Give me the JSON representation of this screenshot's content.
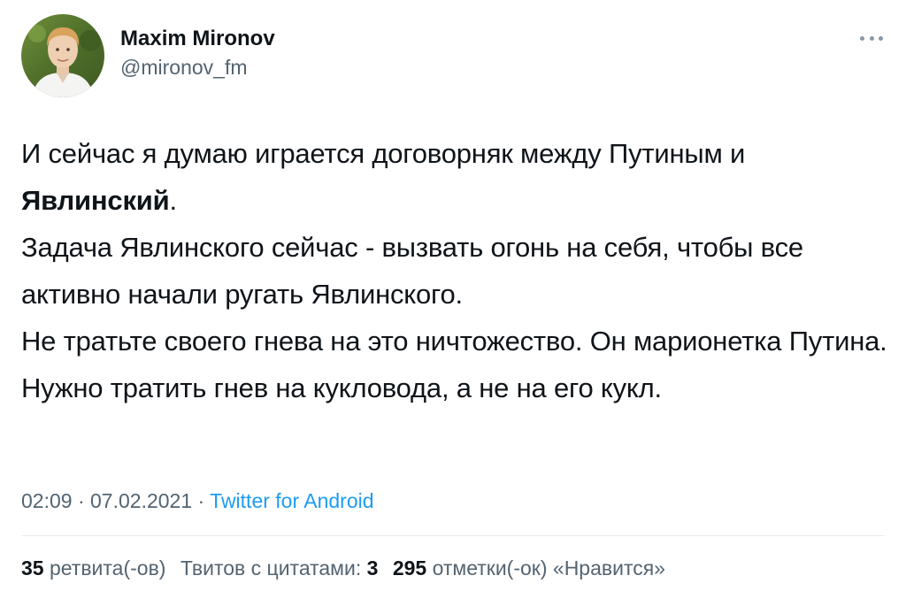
{
  "author": {
    "name": "Maxim Mironov",
    "handle": "@mironov_fm"
  },
  "tweet": {
    "line1": "И сейчас я думаю играется договорняк между Путиным и",
    "bold_name": "Явлинский",
    "bold_suffix": ".",
    "paragraph2": "Задача Явлинского сейчас - вызвать огонь на себя, чтобы все активно начали ругать Явлинского.",
    "paragraph3": "Не тратьте своего гнева на это ничтожество. Он марионетка Путина. Нужно тратить гнев на кукловода, а не на его кукл."
  },
  "meta": {
    "time": "02:09",
    "separator1": " · ",
    "date": "07.02.2021",
    "separator2": " · ",
    "source": "Twitter for Android"
  },
  "stats": {
    "retweets_count": "35",
    "retweets_label": "ретвита(-ов)",
    "quotes_label": "Твитов с цитатами:",
    "quotes_count": "3",
    "likes_count": "295",
    "likes_label": "отметки(-ок) «Нравится»"
  },
  "icons": {
    "more": "more-dots-icon",
    "avatar": "profile-photo"
  },
  "colors": {
    "text_primary": "#0f1419",
    "text_secondary": "#536471",
    "link": "#1d9bf0",
    "divider": "#e6ecf0"
  }
}
